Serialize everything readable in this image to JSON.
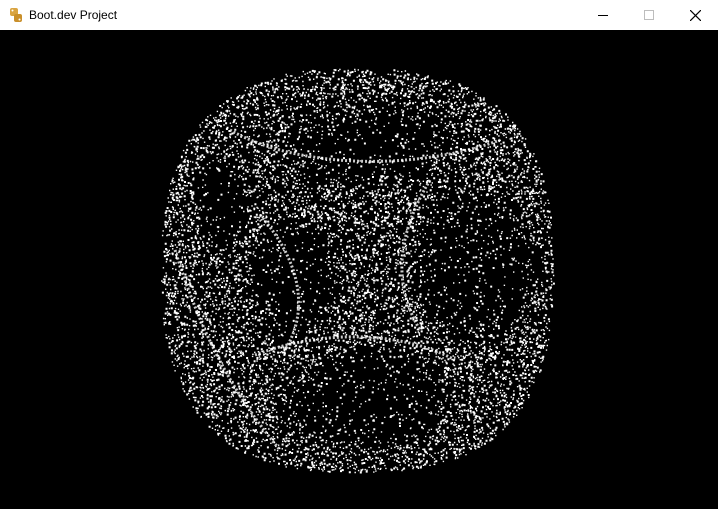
{
  "window": {
    "title": "Boot.dev Project",
    "app_icon": "python-icon",
    "controls": [
      "minimize-icon",
      "maximize-icon",
      "close-icon"
    ]
  },
  "canvas": {
    "background": "#000000",
    "point_color": "#ffffff"
  }
}
